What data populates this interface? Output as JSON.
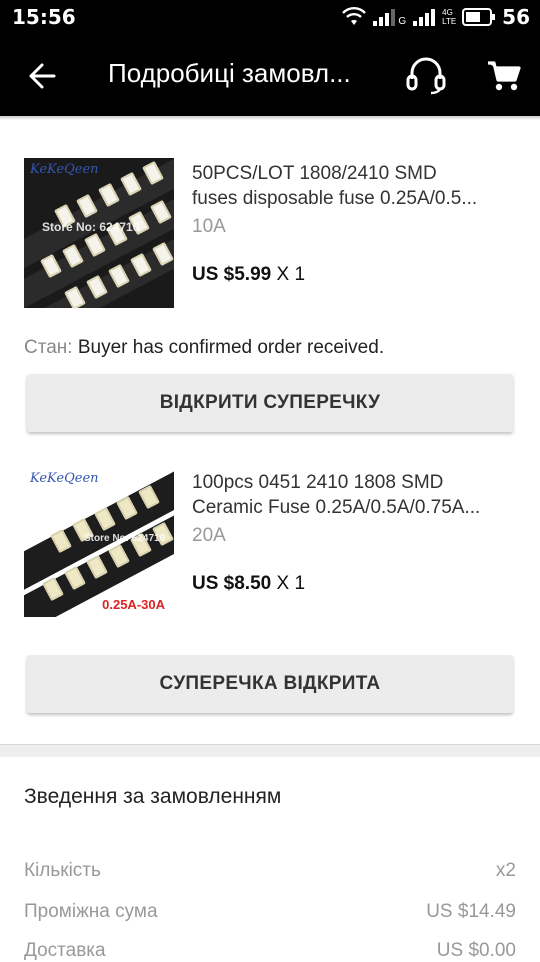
{
  "status_bar": {
    "time": "15:56",
    "network_label": "G",
    "lte_label": "4G LTE",
    "battery": "56"
  },
  "header": {
    "title": "Подробиці замовл...",
    "back_icon": "arrow-left-icon",
    "support_icon": "headset-icon",
    "cart_icon": "cart-icon"
  },
  "products": [
    {
      "title_line1": "50PCS/LOT 1808/2410 SMD",
      "title_line2": "fuses disposable fuse 0.25A/0.5...",
      "variant": "10A",
      "price": "US $5.99",
      "qty": "X 1",
      "thumb_brand": "KeKeQeen",
      "thumb_watermark": "Store No: 624710"
    },
    {
      "title_line1": "100pcs 0451 2410 1808 SMD",
      "title_line2": "Ceramic Fuse 0.25A/0.5A/0.75A...",
      "variant": "20A",
      "price": "US $8.50",
      "qty": "X 1",
      "thumb_brand": "KeKeQeen",
      "thumb_watermark": "Store No: 624710",
      "thumb_range": "0.25A-30A"
    }
  ],
  "order_status": {
    "label": "Стан:",
    "value": "Buyer has confirmed order received."
  },
  "buttons": {
    "open_dispute": "ВІДКРИТИ СУПЕРЕЧКУ",
    "dispute_opened": "СУПЕРЕЧКА ВІДКРИТА"
  },
  "summary": {
    "title": "Зведення за замовленням",
    "rows": [
      {
        "label": "Кількість",
        "value": "x2"
      },
      {
        "label": "Проміжна сума",
        "value": "US $14.49"
      },
      {
        "label": "Доставка",
        "value": "US $0.00"
      }
    ]
  }
}
